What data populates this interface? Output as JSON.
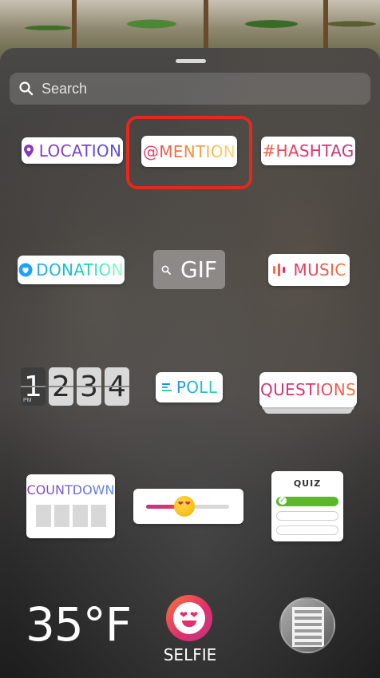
{
  "search": {
    "placeholder": "Search"
  },
  "stickers": {
    "location": "LOCATION",
    "mention": "@MENTION",
    "hashtag": "#HASHTAG",
    "donation": "DONATION",
    "gif": "GIF",
    "music": "MUSIC",
    "clock": {
      "digits": [
        "1",
        "2",
        "3",
        "4"
      ],
      "period": "PM"
    },
    "poll": "POLL",
    "questions": "QUESTIONS",
    "countdown": "COUNTDOWN",
    "emoji_slider": {
      "value": 0.46
    },
    "quiz": "QUIZ"
  },
  "bottom": {
    "temperature": "35°F",
    "selfie_label": "SELFIE"
  },
  "colors": {
    "highlight": "#e5271e",
    "quiz_correct": "#5cb82a"
  },
  "icons": [
    "search-icon",
    "location-pin-icon",
    "heart-icon",
    "search-small-icon",
    "music-bars-icon",
    "poll-lines-icon",
    "heart-eyes-emoji-icon",
    "selfie-icon",
    "gallery-thumbnail"
  ]
}
